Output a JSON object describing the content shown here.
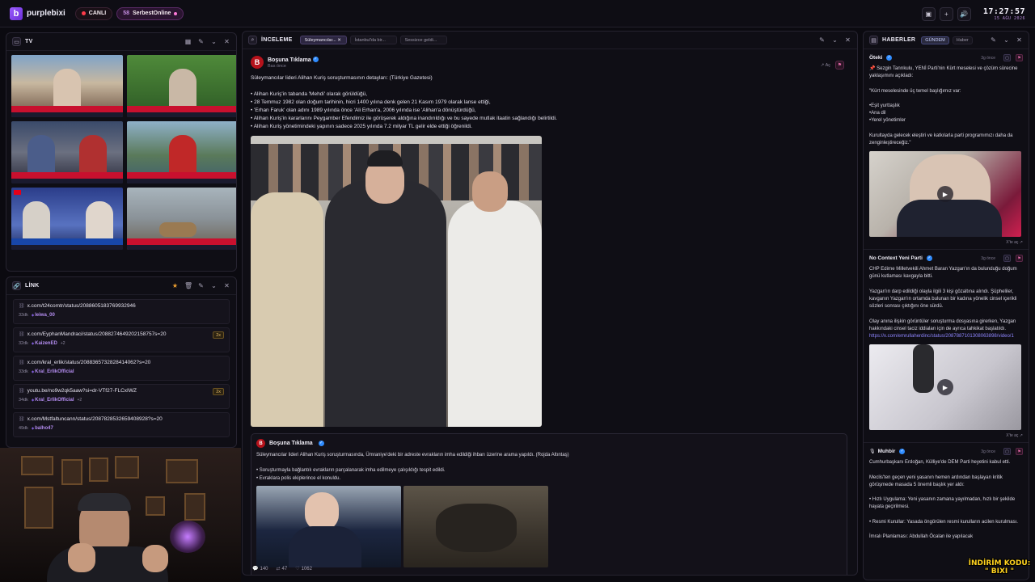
{
  "app": {
    "brand": "purplebixi",
    "live_label": "CANLI",
    "online_count": "58",
    "online_label": "SerbestOnline",
    "clock_time": "17:27:57",
    "clock_date": "15 AĞU 2026"
  },
  "tv": {
    "title": "TV",
    "thumbs": [
      {
        "caption": "PAZAR ARABALARI DOMBOS"
      },
      {
        "caption": "BOĞOSTAL SIRASINDA BİLE TENDİT GELDİ"
      },
      {
        "caption": "DENİZDEN DÖNERKEN KAYBOLDULAR"
      },
      {
        "caption": "SIR OAM ARANAN ŞAHSİYETLER TUTUYORLAR"
      },
      {
        "caption": "NEDEN ÇE OPTİKS SAVUNMA ANLAŞMASI"
      },
      {
        "caption": ""
      }
    ]
  },
  "link": {
    "title": "LİNK",
    "items": [
      {
        "url": "x.com/t24comtr/status/2088605183769932946",
        "age": "33dk",
        "user": "leiwa_00",
        "extra": "",
        "dup": ""
      },
      {
        "url": "x.com/EyphanMandraci/status/2088274649202158757s=20",
        "age": "32dk",
        "user": "KaizenED",
        "extra": "+2",
        "dup": "2x"
      },
      {
        "url": "x.com/kral_erlik/status/2088365732828414062?s=20",
        "age": "33dk",
        "user": "Kral_ErlikOfficial",
        "extra": "",
        "dup": ""
      },
      {
        "url": "youtu.be/no9w2qk5aaw?si=dr-VTf27-FLCxIWZ",
        "age": "34dk",
        "user": "Kral_ErlikOfficial",
        "extra": "+2",
        "dup": "2x"
      },
      {
        "url": "x.com/Mstfaltuncann/status/2087828532659408928?s=20",
        "age": "49dk",
        "user": "balho47",
        "extra": "",
        "dup": ""
      }
    ]
  },
  "inceleme": {
    "title": "İNCELEME",
    "tabs": [
      "Süleymancılar...",
      "İstanbul'da bir...",
      "Sessizce geldi..."
    ],
    "post": {
      "author": "Boşuna Tıklama",
      "time": "Bas önce",
      "open_label": "Aç",
      "lines": [
        "Süleymancılar lideri Alihan Kuriş soruşturmasının detayları: (Türkiye Gazetesi)",
        "",
        "• Alihan Kuriş'in tabanda 'Mehdi' olarak görüldüğü,",
        "• 28 Temmuz 1982 olan doğum tarihinin, hicri 1400 yılına denk gelen 21 Kasım 1979 olarak lanse ettiği,",
        "• 'Erhan Faruk' olan adını 1989 yılında önce 'Ali Erhan'a, 2006 yılında ise 'Alihan'a dönüştürdüğü,",
        "• Alihan Kuriş'in kararlarını Peygamber Efendimiz ile görüşerek aldığına inandırıldığı ve bu sayede mutlak itaatin sağlandığı belirtildi.",
        "• Alihan Kuriş yönetimindeki yapının sadece 2025 yılında 7.2 milyar TL gelir elde ettiği öğrenildi."
      ]
    },
    "sub_post": {
      "author": "Boşuna Tıklama",
      "lines": [
        "Süleymancılar lideri Alihan Kuriş soruşturmasında, Ümraniye'deki bir adreste evrakların imha edildiği ihbarı üzerine arama yapıldı. (Rojda Altıntaş)",
        "",
        "• Soruşturmayla bağlantılı evrakların parçalanarak imha edilmeye çalışıldığı tespit edildi.",
        "• Evraklara polis ekiplerince el konuldu."
      ]
    },
    "stats": {
      "replies": "140",
      "reposts": "47",
      "likes": "1062"
    }
  },
  "haberler": {
    "title": "HABERLER",
    "tabs": [
      "GÜNDEM",
      "Haber"
    ],
    "items": [
      {
        "author": "Öteki",
        "time": "3g önce",
        "lines": [
          "📌 Sezgin Tanrıkulu, YENİ Parti'nin Kürt meselesi ve çözüm sürecine yaklaşımını açıkladı:",
          "",
          "\"Kürt meselesinde üç temel başlığımız var:",
          "",
          "•Eşit yurttaşlık",
          "•Ana dil",
          "•Yerel yönetimler",
          "",
          "Kurultayda gelecek eleştiri ve katkılarla parti programımızı daha da zenginleştireceğiz.\""
        ],
        "link": "",
        "open_label": "X'te aç ↗"
      },
      {
        "author": "No Context Yeni Parti",
        "time": "3g önce",
        "lines": [
          "CHP Edirne Milletvekili Ahmet Baran Yazgan'ın da bulunduğu doğum günü kutlaması kavgayla bitti.",
          "",
          "Yazgan'ın darp edildiği olayla ilgili 3 kişi gözaltına alındı. Şüpheliler, kavganın Yazgan'ın ortamda bulunan bir kadına yönelik cinsel içerikli sözleri sonrası çıktığını öne sürdü.",
          "",
          "Olay anına ilişkin görüntüler soruşturma dosyasına girerken, Yazgan hakkındaki cinsel taciz iddiaları için de ayrıca tahkikat başlatıldı."
        ],
        "link": "https://x.com/emrullaherdinc/status/2087887101308063898/video/1",
        "open_label": "X'te aç ↗"
      },
      {
        "author": "Muhbir",
        "time": "3g önce",
        "lines": [
          "Cumhurbaşkanı Erdoğan, Külliye'de DEM Parti heyetini kabul etti.",
          "",
          "Meclis'ten geçen yeni yasanın hemen ardından başlayan kritik görüşmede masada 5 önemli başlık yer aldı:",
          "",
          "• Hızlı Uygulama: Yeni yasanın zamana yayılmadan, hızlı bir şekilde hayata geçirilmesi.",
          "",
          "• Resmi Kurullar: Yasada öngörülen resmi kurulların acilen kurulması.",
          "",
          "İmralı Planlaması: Abdullah Öcalan ile yapılacak"
        ],
        "link": "",
        "open_label": ""
      }
    ]
  },
  "promo": {
    "line1": "İNDİRİM KODU:",
    "line2": "\" BIXI \""
  },
  "colors": {
    "accent": "#9b5cff",
    "live": "#ff3b4a",
    "link_user": "#b48df0"
  }
}
